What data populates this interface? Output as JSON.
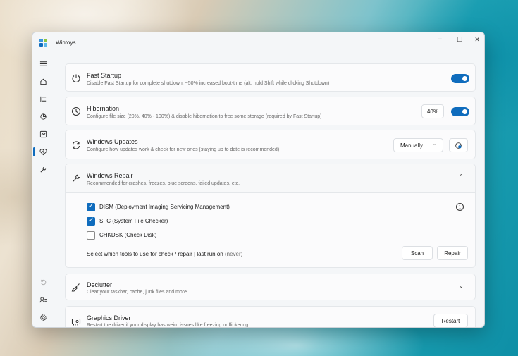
{
  "window": {
    "title": "Wintoys",
    "minimize": "–",
    "maximize": "☐",
    "close": "✕"
  },
  "sidebar": {
    "items": [
      {
        "name": "menu-icon"
      },
      {
        "name": "home-icon"
      },
      {
        "name": "list-icon"
      },
      {
        "name": "apps-icon"
      },
      {
        "name": "performance-icon"
      },
      {
        "name": "health-icon",
        "selected": true
      },
      {
        "name": "wrench-icon"
      }
    ],
    "bottom": [
      {
        "name": "undo-icon"
      },
      {
        "name": "account-icon"
      },
      {
        "name": "settings-icon"
      }
    ]
  },
  "cards": {
    "fast_startup": {
      "title": "Fast Startup",
      "subtitle": "Disable Fast Startup for complete shutdown, ~50% increased boot-time (alt: hold Shift while clicking Shutdown)",
      "toggle_on": true
    },
    "hibernation": {
      "title": "Hibernation",
      "subtitle": "Configure file size (20%, 40% - 100%) & disable hibernation to free some storage (required by Fast Startup)",
      "size_value": "40%",
      "toggle_on": true
    },
    "windows_updates": {
      "title": "Windows Updates",
      "subtitle": "Configure how updates work & check for new ones (staying up to date is recommended)",
      "mode": "Manually"
    },
    "windows_repair": {
      "title": "Windows Repair",
      "subtitle": "Recommended for crashes, freezes, blue screens, failed updates, etc.",
      "tools": [
        {
          "label": "DISM (Deployment Imaging Servicing Management)",
          "checked": true
        },
        {
          "label": "SFC (System File Checker)",
          "checked": true
        },
        {
          "label": "CHKDSK (Check Disk)",
          "checked": false
        }
      ],
      "status_prefix": "Select which tools to use for check / repair | last run on ",
      "status_value": "(never)",
      "scan_label": "Scan",
      "repair_label": "Repair"
    },
    "declutter": {
      "title": "Declutter",
      "subtitle": "Clear your taskbar, cache, junk files and more"
    },
    "graphics_driver": {
      "title": "Graphics Driver",
      "subtitle": "Restart the driver if your display has weird issues like freezing or flickering",
      "restart_label": "Restart"
    }
  },
  "colors": {
    "accent": "#0f6cbd",
    "window_bg": "#f4f6f8",
    "card_bg": "#fbfbfc"
  }
}
